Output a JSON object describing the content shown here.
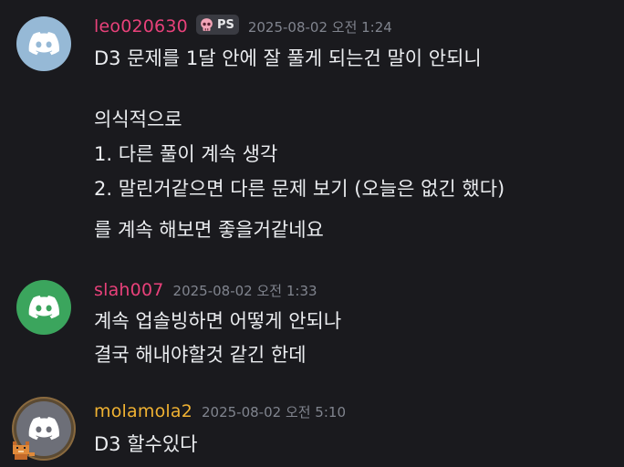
{
  "messages": [
    {
      "author": "leo020630",
      "author_color": "#e8417a",
      "avatar_bg": "#96b9d6",
      "avatar_icon": "discord-icon",
      "tag": {
        "icon": "skull-icon",
        "label": "PS"
      },
      "timestamp": "2025-08-02 오전 1:24",
      "lines": [
        "D3 문제를 1달 안에 잘 풀게 되는건 말이 안되니",
        "의식적으로",
        "1. 다른 풀이 계속 생각",
        "2. 말린거같으면 다른 문제 보기 (오늘은 없긴 했다)",
        "를 계속 해보면 좋을거같네요"
      ]
    },
    {
      "author": "slah007",
      "author_color": "#e8417a",
      "avatar_bg": "#3ba55d",
      "avatar_icon": "discord-icon",
      "timestamp": "2025-08-02 오전 1:33",
      "lines": [
        "계속 업솔빙하면 어떻게 안되나",
        "결국 해내야할것 같긴 한데"
      ]
    },
    {
      "author": "molamola2",
      "author_color": "#f0b232",
      "avatar_bg": "#6d6f78",
      "avatar_icon": "discord-icon",
      "avatar_decoration": "pixel-frame-cat-icon",
      "timestamp": "2025-08-02 오전 5:10",
      "lines": [
        "D3 할수있다"
      ]
    }
  ]
}
